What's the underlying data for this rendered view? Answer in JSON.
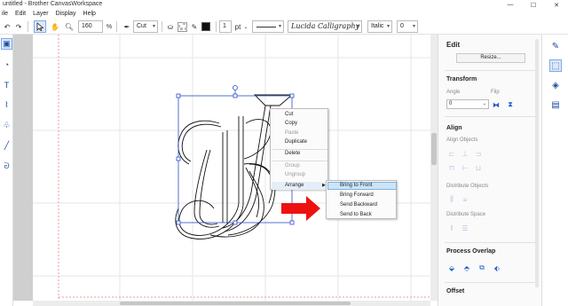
{
  "window": {
    "title": "untitled - Brother CanvasWorkspace",
    "minimize": "—",
    "maximize": "☐",
    "close": "✕"
  },
  "menu": [
    "ile",
    "Edit",
    "Layer",
    "Display",
    "Help"
  ],
  "toolbar": {
    "zoom": "160",
    "zoom_unit": "%",
    "cut_label": "Cut",
    "stroke_width": "1",
    "stroke_unit": "pt",
    "font_name": "Lucida Calligraphy",
    "font_style": "Italic",
    "font_size": "0"
  },
  "context_menu": {
    "items": [
      "Cut",
      "Copy",
      "Paste",
      "Duplicate",
      "Delete",
      "Group",
      "Ungroup",
      "Arrange"
    ],
    "disabled": [
      "Paste",
      "Group",
      "Ungroup"
    ]
  },
  "arrange_submenu": [
    "Bring to Front",
    "Bring Forward",
    "Send Backward",
    "Send to Back"
  ],
  "panel": {
    "title": "Edit",
    "resize": "Resize...",
    "transform": "Transform",
    "angle_label": "Angle",
    "angle_value": "0",
    "flip_label": "Flip",
    "align": "Align",
    "align_objects": "Align Objects",
    "distribute_objects": "Distribute Objects",
    "distribute_space": "Distribute Space",
    "process_overlap": "Process Overlap",
    "offset": "Offset"
  },
  "colors": {
    "selection": "#2a4fc4",
    "arrow": "#ee1111",
    "accent": "#1f5fc8",
    "highlight": "#cde4f7"
  }
}
